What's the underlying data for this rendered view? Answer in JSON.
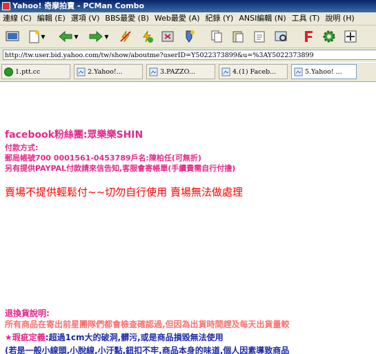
{
  "window": {
    "title": "Yahoo! 奇摩拍賣 - PCMan Combo"
  },
  "menu": [
    "連線 (C)",
    "編輯 (E)",
    "選項 (V)",
    "BBS最愛 (B)",
    "Web最愛 (A)",
    "紀錄 (Y)",
    "ANSI編輯 (N)",
    "工具 (T)",
    "說明 (H)"
  ],
  "toolbar": {
    "icons": [
      "connect-icon",
      "new-icon",
      "back-icon",
      "forward-icon",
      "disconnect-icon",
      "reconnect-icon",
      "close-all-icon",
      "pin-icon",
      "copy-icon",
      "paste-icon",
      "clipboard-icon",
      "screenshot-icon",
      "font-icon",
      "settings-icon",
      "fullscreen-icon"
    ]
  },
  "address": {
    "url": "http://tw.user.bid.yahoo.com/tw/show/aboutme?userID=Y5022373899&u=%3AY5022373899"
  },
  "tabs": [
    {
      "label": "1.ptt.cc",
      "active": false
    },
    {
      "label": "2.Yahoo!...",
      "active": false
    },
    {
      "label": "3.PAZZO...",
      "active": false
    },
    {
      "label": "4.(1) Faceb...",
      "active": false
    },
    {
      "label": "5.Yahoo! ...",
      "active": true
    }
  ],
  "page": {
    "fb_line": "facebook粉絲團:眾樂樂SHIN",
    "pay_heading": "付款方式:",
    "pay_account": "郵局帳號700  0001561-0453789戶名:陳柏任(可無折)",
    "pay_paypal": "另有提供PAYPAL付款請來信告知,客服會寄帳單(手續費需自行付擔)",
    "warning": "賣場不提供輕鬆付~~切勿自行使用 賣場無法做處理",
    "return_heading": "退換貨說明:",
    "return_line1": "所有商品在寄出前星團隊們都會檢查確認過,但因為出貨時間趕及每天出貨量較",
    "defect_star": "★",
    "defect_label": "瑕疵定義",
    "defect_text": ":超過1cm大的破洞,髒污,或是商品損毀無法使用",
    "return_line3": "(若是一般小線頭,小脫線,小汙點,鈕扣不牢,商品本身的味道,個人因素導致商品"
  },
  "colors": {
    "pink": "#e4288a",
    "red": "#ff0000",
    "navy": "#1d2aa5",
    "salmon": "#ff6f6f"
  }
}
